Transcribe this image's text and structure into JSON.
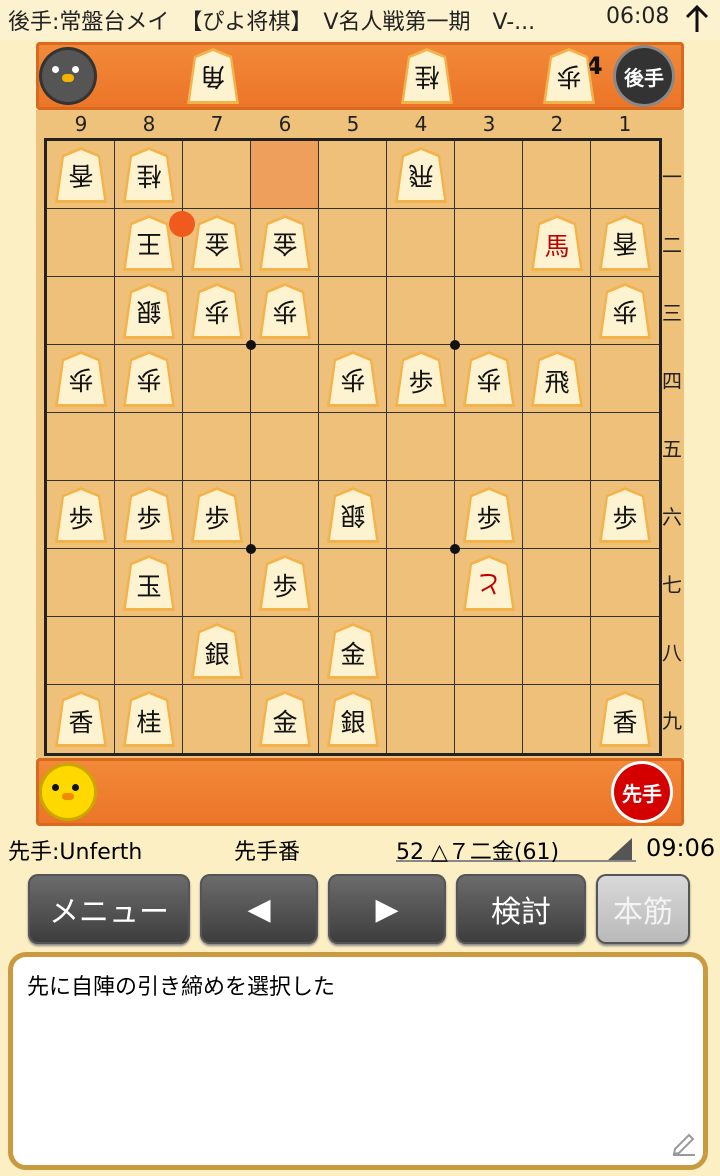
{
  "status_bar": {
    "title": "後手:常盤台メイ　【ぴよ将棋】　V名人戦第一期　V-...",
    "time": "06:08"
  },
  "gote": {
    "hand_pieces": [
      "角",
      "桂",
      "歩"
    ],
    "pawn_count": "4",
    "badge": "後手"
  },
  "sente": {
    "badge": "先手"
  },
  "file_labels": [
    "9",
    "8",
    "7",
    "6",
    "5",
    "4",
    "3",
    "2",
    "1"
  ],
  "rank_labels": [
    "一",
    "二",
    "三",
    "四",
    "五",
    "六",
    "七",
    "八",
    "九"
  ],
  "board": {
    "pieces": [
      {
        "f": 9,
        "r": 1,
        "k": "香",
        "s": "gote"
      },
      {
        "f": 8,
        "r": 1,
        "k": "桂",
        "s": "gote"
      },
      {
        "f": 4,
        "r": 1,
        "k": "飛",
        "s": "gote"
      },
      {
        "f": 8,
        "r": 2,
        "k": "王",
        "s": "gote"
      },
      {
        "f": 7,
        "r": 2,
        "k": "金",
        "s": "gote"
      },
      {
        "f": 6,
        "r": 2,
        "k": "金",
        "s": "gote"
      },
      {
        "f": 2,
        "r": 2,
        "k": "馬",
        "s": "sente",
        "red": true
      },
      {
        "f": 1,
        "r": 2,
        "k": "香",
        "s": "gote"
      },
      {
        "f": 8,
        "r": 3,
        "k": "銀",
        "s": "gote"
      },
      {
        "f": 7,
        "r": 3,
        "k": "歩",
        "s": "gote"
      },
      {
        "f": 6,
        "r": 3,
        "k": "歩",
        "s": "gote"
      },
      {
        "f": 1,
        "r": 3,
        "k": "歩",
        "s": "gote"
      },
      {
        "f": 9,
        "r": 4,
        "k": "歩",
        "s": "gote"
      },
      {
        "f": 8,
        "r": 4,
        "k": "歩",
        "s": "gote"
      },
      {
        "f": 5,
        "r": 4,
        "k": "歩",
        "s": "gote"
      },
      {
        "f": 4,
        "r": 4,
        "k": "歩",
        "s": "sente"
      },
      {
        "f": 3,
        "r": 4,
        "k": "歩",
        "s": "gote"
      },
      {
        "f": 2,
        "r": 4,
        "k": "飛",
        "s": "sente"
      },
      {
        "f": 9,
        "r": 6,
        "k": "歩",
        "s": "sente"
      },
      {
        "f": 8,
        "r": 6,
        "k": "歩",
        "s": "sente"
      },
      {
        "f": 7,
        "r": 6,
        "k": "歩",
        "s": "sente"
      },
      {
        "f": 5,
        "r": 6,
        "k": "銀",
        "s": "gote"
      },
      {
        "f": 3,
        "r": 6,
        "k": "歩",
        "s": "sente"
      },
      {
        "f": 1,
        "r": 6,
        "k": "歩",
        "s": "sente"
      },
      {
        "f": 8,
        "r": 7,
        "k": "玉",
        "s": "sente"
      },
      {
        "f": 6,
        "r": 7,
        "k": "歩",
        "s": "sente"
      },
      {
        "f": 3,
        "r": 7,
        "k": "と",
        "s": "gote",
        "red": true
      },
      {
        "f": 7,
        "r": 8,
        "k": "銀",
        "s": "sente"
      },
      {
        "f": 5,
        "r": 8,
        "k": "金",
        "s": "sente"
      },
      {
        "f": 9,
        "r": 9,
        "k": "香",
        "s": "sente"
      },
      {
        "f": 8,
        "r": 9,
        "k": "桂",
        "s": "sente"
      },
      {
        "f": 6,
        "r": 9,
        "k": "金",
        "s": "sente"
      },
      {
        "f": 5,
        "r": 9,
        "k": "銀",
        "s": "sente"
      },
      {
        "f": 1,
        "r": 9,
        "k": "香",
        "s": "sente"
      }
    ],
    "highlight": {
      "f": 6,
      "r": 1
    },
    "last_move_marker": {
      "f": 7,
      "r": 2
    }
  },
  "info_bar": {
    "sente_name": "先手:Unferth",
    "turn": "先手番",
    "move": "52 △７二金(61)",
    "clock": "09:06"
  },
  "buttons": {
    "menu": "メニュー",
    "prev": "◀",
    "next": "▶",
    "analyze": "検討",
    "mainline": "本筋"
  },
  "comment": "先に自陣の引き締めを選択した",
  "colors": {
    "accent": "#ec7427",
    "board": "#eec07a",
    "frame": "#c99a3f"
  }
}
